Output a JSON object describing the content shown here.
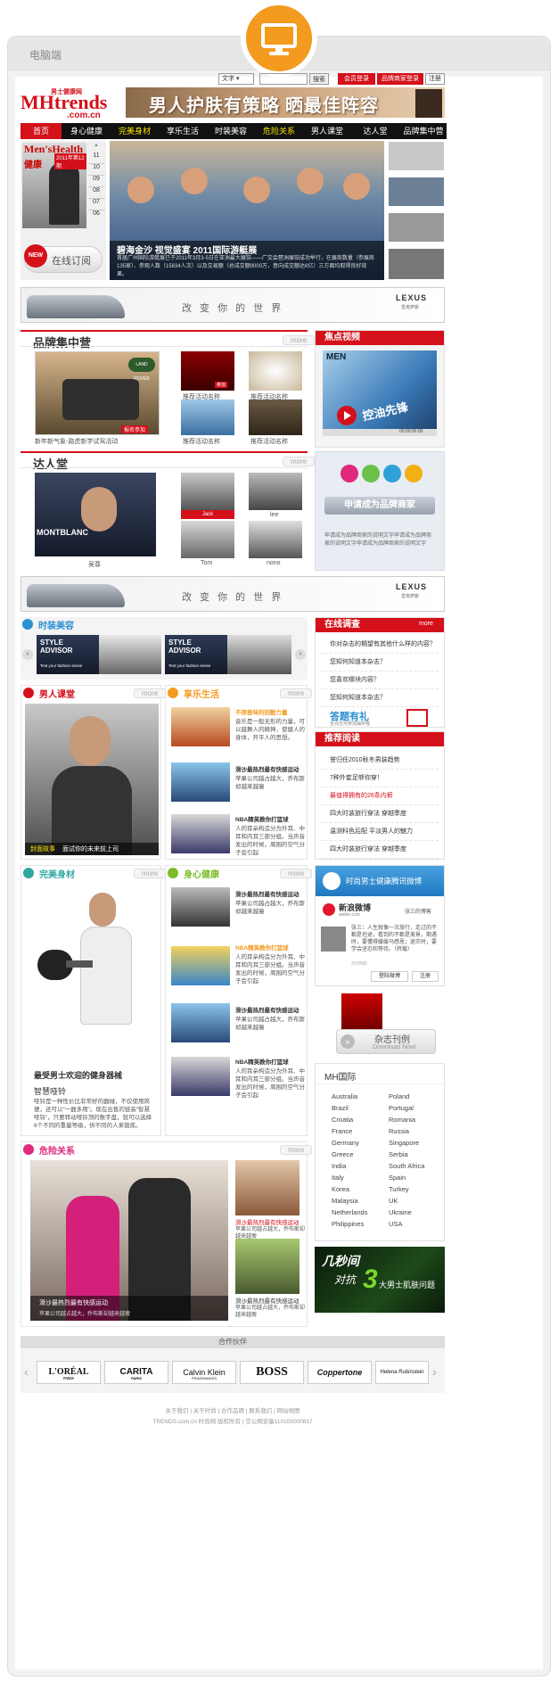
{
  "frame": {
    "title": "电脑端"
  },
  "colors": {
    "accent": "#d4101a",
    "orange": "#f39a1f",
    "nav_bg": "#111111",
    "nav_active": "#d4101a"
  },
  "topbar": {
    "lang_select": "文字",
    "search_btn": "搜索",
    "member_login": "会员登录",
    "merchant_login": "品牌商家登录",
    "register": "注册"
  },
  "logo": {
    "main": "MHtrends",
    "cn": "男士健康网",
    "domain": ".com.cn"
  },
  "banner": {
    "text": "男人护肤有策略 晒最佳阵容"
  },
  "nav": [
    "首页",
    "身心健康",
    "完美身材",
    "享乐生活",
    "时装美容",
    "危险关系",
    "男人课堂",
    "达人堂",
    "品牌集中营"
  ],
  "magazine": {
    "issue": "2011年第12期",
    "name": "Men'sHealth",
    "cn": "健康",
    "pages": [
      "11",
      "10",
      "09",
      "08",
      "07",
      "06",
      "05"
    ],
    "subscribe": "在线订阅",
    "new_tag": "NEW"
  },
  "hero": {
    "title": "碧海金沙 视觉盛宴 2011国际游艇展",
    "desc": "首届广州国际游艇展已于2011年3月3-5日在亚洲最大展馆——广交会琶洲展馆成功举行，在展商数量（参展商135家）、参观人数（15834人次）以及交易额（总成交额9000万，意向成交额达6亿）三方面均取得良好效果。"
  },
  "ad": {
    "slogan": "改 变 你 的 世 界",
    "lexus": "LEXUS",
    "lexus_cn": "雷克萨斯"
  },
  "brands": {
    "title": "品牌集中营",
    "more": "more",
    "main_caption": "新年新气象-路虎新学试驾活动",
    "apply": "报名参加",
    "join": "参加",
    "items": [
      "推荐活动名称",
      "推荐活动名称",
      "推荐活动名称",
      "推荐活动名称"
    ]
  },
  "focus_video": {
    "title": "焦点视频",
    "time": "00:00:00.00",
    "text": "控油先锋",
    "brand": "MEN"
  },
  "talent": {
    "title": "达人堂",
    "more": "more",
    "main": "吴尊",
    "items": [
      "Jack",
      "lee",
      "Tom",
      "nono"
    ],
    "brand": "MONTBLANC"
  },
  "apply_panel": {
    "button": "申请成为品牌商家",
    "desc": "申请成为品牌商家的说明文字申请成为品牌商家的说明文字申请成为品牌商家的说明文字"
  },
  "fashion": {
    "title": "时装美容",
    "card_title": "STYLE ADVISOR",
    "card_sub": "Test your fashion sense"
  },
  "survey": {
    "title": "在线调查",
    "more": "more",
    "items": [
      "你对杂志的期望有其他什么样的内容？",
      "您知何知道本杂志？",
      "您喜欢哪块内容？",
      "您知何知道本杂志？"
    ],
    "banner": "答题有礼",
    "banner_sub": "全完还可参加抽奖哦"
  },
  "men_class": {
    "title": "男人课堂",
    "more": "more",
    "caption_a": "封面故事",
    "caption_b": "面试你的未来前上司"
  },
  "leisure": {
    "title": "享乐生活",
    "more": "more",
    "items": [
      {
        "t": "不邢尝味的回勤力量",
        "d": "音乐是一般无形的力量，可以鼓舞人的精神，使健人的身体，开平人的思想。",
        "hl": true
      },
      {
        "t": "滑沙最热烈最有快感运动",
        "d": "苹果公司越占越大，乔布斯却越来越瘦",
        "hl": false
      },
      {
        "t": "NBA精英教你打篮球",
        "d": "人的耳朵构造分为外耳、中耳和内耳三部分组。当声音发出的时候，周围的空气分子会引起",
        "hl": false
      }
    ]
  },
  "recommend": {
    "title": "推荐阅读",
    "items": [
      "誉归任2010秋冬男装趋势",
      "7种外套足够你穿！",
      "最值得拥有的26条内裤",
      "四大时装旅行穿法 穿越季度",
      "温测科色后配 平淡男人的魅力",
      "四大时装旅行穿法 穿越季度"
    ]
  },
  "fitness": {
    "title": "完美身材",
    "more": "more",
    "headline": "最受男士欢迎的健身器械",
    "sub": "智慧哑铃",
    "desc": "哑铃是一种性价比非常好的器械，不仅使用简便，还可以“一器多用”。现在出售的链装“智慧哑铃”，只要转动哑铃顶的数字盘，就可以选择6个不同的重量等级，供不同的人来锻炼。"
  },
  "health": {
    "title": "身心健康",
    "more": "more",
    "items": [
      {
        "t": "滑沙最热烈最有快感运动",
        "d": "苹果公司越占越大，乔布斯却越来越瘦",
        "hl": false
      },
      {
        "t": "NBA精英教你打篮球",
        "d": "人的耳朵构造分为外耳、中耳和内耳三部分组。当声音发出的时候，周围的空气分子会引起",
        "hl": true
      },
      {
        "t": "滑沙最热烈最有快感运动",
        "d": "苹果公司越占越大，乔布斯却越来越瘦",
        "hl": false
      },
      {
        "t": "NBA精英教你打篮球",
        "d": "人的耳朵构造分为外耳、中耳和内耳三部分组。当声音发出的时候，周围的空气分子会引起",
        "hl": false
      }
    ]
  },
  "weibo": {
    "title": "时尚男士健康腾讯微博",
    "logo": "新浪微博",
    "logo_en": "weibo.com",
    "user": "张三的博客",
    "post": "张三：人生就像一次旅行，走过的不都是坦途，看到的不都是美景，期遇时，要懂得缓缓马感恩；迷茫时，要学会坚忍和等待。（转载）",
    "time": "3分钟前",
    "login": "登陆微博",
    "register": "注册"
  },
  "journal": {
    "title": "杂志刊例",
    "sub": "Download Now!"
  },
  "intl": {
    "title": "MH国际",
    "left": [
      "Australia",
      "Brazil",
      "Croatia",
      "France",
      "Germany",
      "Greece",
      "India",
      "Italy",
      "Korea",
      "Malaysia",
      "Netherlands",
      "Philippines"
    ],
    "right": [
      "Poland",
      "Portugal",
      "Romania",
      "Russia",
      "Singapore",
      "Serbia",
      "South Africa",
      "Spain",
      "Turkey",
      "UK",
      "Ukraine",
      "USA"
    ]
  },
  "danger": {
    "title": "危险关系",
    "more": "more",
    "main_t": "滑沙最热烈最有快感运动",
    "main_d": "苹果公司越占越大，乔布斯却越来越瘦",
    "items": [
      {
        "t": "滑沙最热烈最有快感运动",
        "d": "苹果公司越占越大，乔布斯却越来越瘦",
        "hl": true
      },
      {
        "t": "滑沙最热烈最有快感运动",
        "d": "苹果公司越占越大，乔布斯却越来越瘦",
        "hl": false
      }
    ]
  },
  "promo": {
    "a": "几秒间",
    "b": "对抗",
    "c": "3",
    "d": "大男士肌肤问题"
  },
  "partners": {
    "title": "合作伙伴",
    "items": [
      "L'ORÉAL",
      "CARITA",
      "Calvin Klein",
      "BOSS",
      "Coppertone",
      "Helena Rubinstein"
    ],
    "loreal_sub": "PARIS",
    "carita_sub": "PARIS",
    "ck_sub": "FRAGRANCES"
  },
  "footer": {
    "links": "关于我们 | 关于时尚 | 合作品牌 | 联系我们 | 网站地图",
    "copy": "TRENDS.com.cn 时尚网 版权所有 | 京公网安备110105000817"
  }
}
